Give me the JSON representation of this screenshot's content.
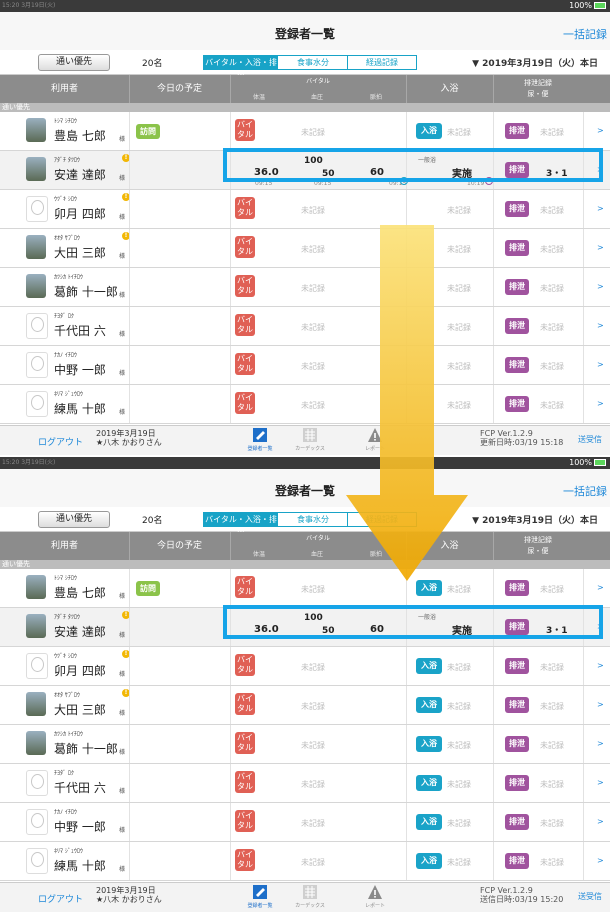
{
  "statusbar": {
    "time": "15:20 3月19日(火)",
    "battery": "100%"
  },
  "title": "登録者一覧",
  "bulk_record": "一括記録",
  "filter": {
    "priority_button": "通い優先",
    "count": "20名",
    "segments": [
      "バイタル・入浴・排泄",
      "食事水分",
      "経過記録"
    ],
    "date": "▼ 2019年3月19日（火）本日"
  },
  "header": {
    "user": "利用者",
    "schedule": "今日の予定",
    "vital": "バイタル",
    "vital_sub": [
      "体温",
      "血圧",
      "脈拍"
    ],
    "bath": "入浴",
    "excretion": "排泄記録",
    "excretion_sub": "尿・便"
  },
  "group_label": "通い優先",
  "labels": {
    "sama": "様",
    "vital_btn": "バイ タル",
    "bath_btn": "入浴",
    "excretion_btn": "排泄",
    "unrecorded": "未記録",
    "chevron": ">",
    "warn": "!",
    "visit": "訪問"
  },
  "users": [
    {
      "kana": "ﾄｼﾏ ｼﾁﾛｳ",
      "name": "豊島 七郎",
      "warn": false,
      "visit": true,
      "photo": true
    },
    {
      "kana": "ｱﾀﾞﾁ ﾀﾂﾛｳ",
      "name": "安達 達郎",
      "warn": true,
      "visit": false,
      "photo": true
    },
    {
      "kana": "ｳﾂﾞｷ ｼﾛｳ",
      "name": "卯月 四郎",
      "warn": true,
      "visit": false,
      "photo": false
    },
    {
      "kana": "ｵｵﾀ ｻﾌﾞﾛｳ",
      "name": "大田 三郎",
      "warn": true,
      "visit": false,
      "photo": true
    },
    {
      "kana": "ｶﾂｼｶ ﾄｲﾁﾛｳ",
      "name": "葛飾 十一郎",
      "warn": false,
      "visit": false,
      "photo": true
    },
    {
      "kana": "ﾁﾖﾀﾞ ﾛｸ",
      "name": "千代田 六",
      "warn": false,
      "visit": false,
      "photo": false
    },
    {
      "kana": "ﾅｶﾉ ｲﾁﾛｳ",
      "name": "中野 一郎",
      "warn": false,
      "visit": false,
      "photo": false
    },
    {
      "kana": "ﾈﾘﾏ ｼﾞｭｳﾛｳ",
      "name": "練馬 十郎",
      "warn": false,
      "visit": false,
      "photo": false
    }
  ],
  "highlighted": {
    "temp": "36.0",
    "bp_high": "100",
    "bp_low": "50",
    "pulse": "60",
    "bath_category": "一般浴",
    "bath_status": "実施",
    "excretion": "3・1",
    "top_times": {
      "temp": "09:15",
      "bp": "09:15",
      "pulse": "09:15",
      "bath": "10:19"
    }
  },
  "footer": {
    "logout": "ログアウト",
    "date": "2019年3月19日",
    "staff": "★八木 かおりさん",
    "tabs": [
      "登録者一覧",
      "カーデックス",
      "レポート"
    ],
    "version": "FCP Ver.1.2.9",
    "top_updated": "更新日時:03/19 15:18",
    "bottom_updated": "送信日時:03/19 15:20",
    "top_send": "送受信",
    "bottom_send": "送受信"
  },
  "colors": {
    "accent": "#1e88d8",
    "highlight": "#16a4e8",
    "arrow": "#f5b800",
    "vital": "#e06055",
    "bath": "#1aa3c8",
    "excretion": "#a0539e"
  }
}
